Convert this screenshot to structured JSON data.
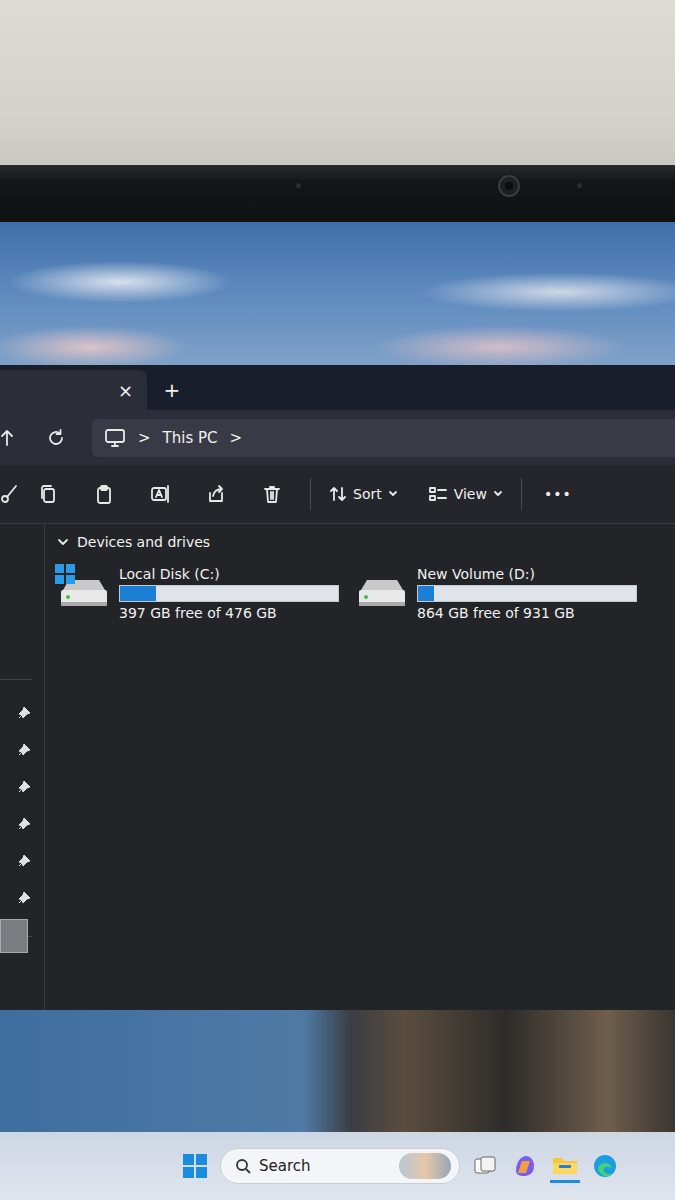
{
  "window": {
    "tab": {
      "close": "×",
      "new": "+",
      "selected": true
    },
    "address": {
      "separators": [
        ">",
        ">"
      ],
      "location": "This PC"
    },
    "toolbar": {
      "sort": "Sort",
      "view": "View",
      "more": "•••"
    },
    "group": {
      "title": "Devices and drives",
      "expanded": true
    },
    "drives": [
      {
        "name": "Local Disk (C:)",
        "free": "397 GB free of 476 GB",
        "level": 0.166,
        "system": true
      },
      {
        "name": "New Volume (D:)",
        "free": "864 GB free of 931 GB",
        "level": 0.072,
        "system": false
      }
    ]
  },
  "taskbar": {
    "search": "Search"
  }
}
